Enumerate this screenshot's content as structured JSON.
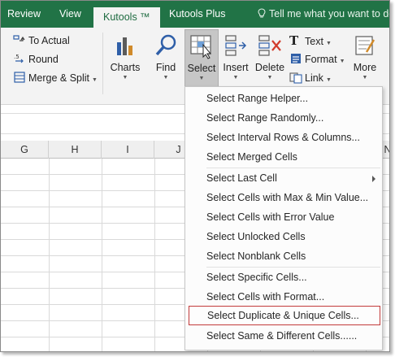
{
  "tabs": {
    "review": "Review",
    "view": "View",
    "kutools": "Kutools ™",
    "kutools_plus": "Kutools Plus",
    "tell_me": "Tell me what you want to do..."
  },
  "ribbon": {
    "to_actual": "To Actual",
    "round": "Round",
    "merge_split": "Merge & Split",
    "charts": "Charts",
    "find": "Find",
    "select": "Select",
    "insert": "Insert",
    "delete": "Delete",
    "text": "Text",
    "format": "Format",
    "link": "Link",
    "more": "More"
  },
  "columns": [
    "G",
    "H",
    "I",
    "J",
    "N"
  ],
  "menu": {
    "items": [
      "Select Range Helper...",
      "Select Range Randomly...",
      "Select Interval Rows & Columns...",
      "Select Merged Cells",
      "Select Last Cell",
      "Select Cells with Max & Min Value...",
      "Select Cells with Error Value",
      "Select Unlocked Cells",
      "Select Nonblank Cells",
      "Select Specific Cells...",
      "Select Cells with Format...",
      "Select Duplicate & Unique Cells...",
      "Select Same & Different Cells......"
    ]
  },
  "colors": {
    "ribbon_green": "#217346",
    "highlight_border": "#c23b3b"
  }
}
